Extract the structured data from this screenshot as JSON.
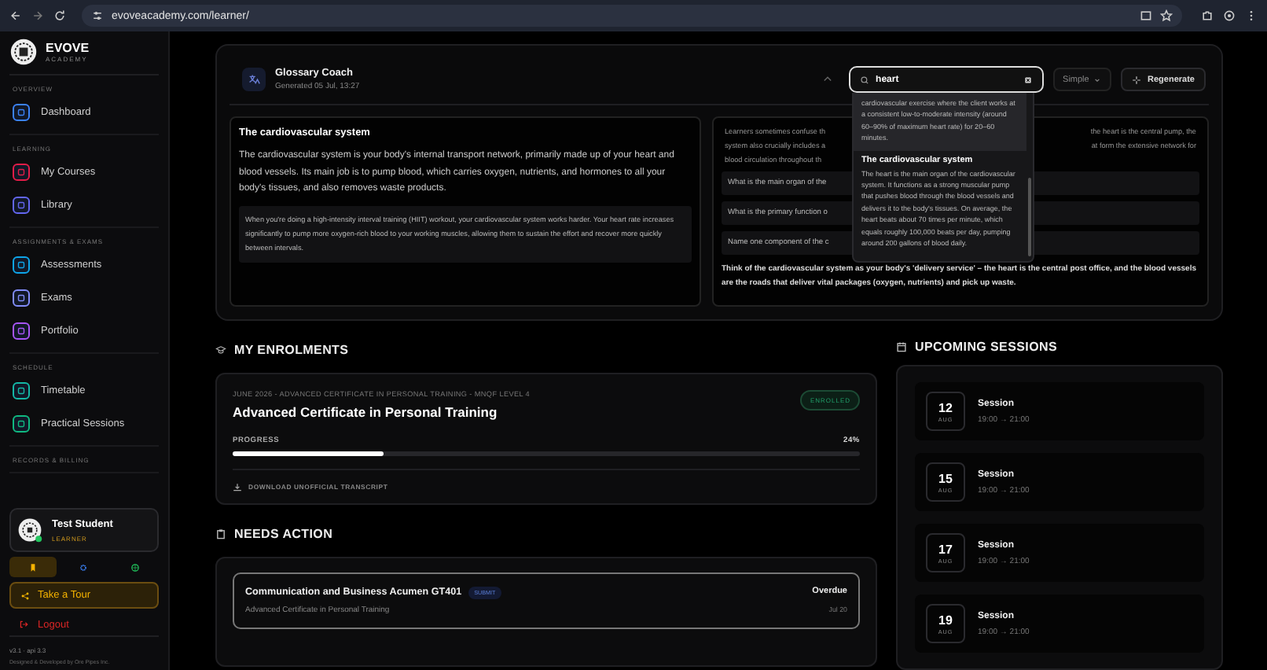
{
  "browser": {
    "url": "evoveacademy.com/learner/"
  },
  "sidebar": {
    "brand": {
      "name": "EVOVE",
      "tagline": "ACADEMY"
    },
    "sections": [
      {
        "heading": "OVERVIEW",
        "items": [
          {
            "label": "Dashboard",
            "color": "#3b82f6"
          }
        ]
      },
      {
        "heading": "LEARNING",
        "items": [
          {
            "label": "My Courses",
            "color": "#e11d48"
          },
          {
            "label": "Library",
            "color": "#6366f1"
          }
        ]
      },
      {
        "heading": "ASSIGNMENTS & EXAMS",
        "items": [
          {
            "label": "Assessments",
            "color": "#0ea5e9"
          },
          {
            "label": "Exams",
            "color": "#818cf8"
          },
          {
            "label": "Portfolio",
            "color": "#a855f7"
          }
        ]
      },
      {
        "heading": "SCHEDULE",
        "items": [
          {
            "label": "Timetable",
            "color": "#14b8a6"
          },
          {
            "label": "Practical Sessions",
            "color": "#10b981"
          }
        ]
      },
      {
        "heading": "RECORDS & BILLING"
      }
    ],
    "user": {
      "name": "Test Student",
      "role": "LEARNER"
    },
    "quick_tabs": [
      {
        "kind": "bookmark",
        "selected": true
      },
      {
        "kind": "gear",
        "selected": false
      },
      {
        "kind": "globe",
        "selected": false
      }
    ],
    "tour_button": "Take a Tour",
    "logout": "Logout",
    "version": "v3.1 · api 3.3",
    "credit": "Designed & Developed by Ore Pipes Inc."
  },
  "glossary": {
    "title": "Glossary Coach",
    "generated": "Generated 05 Jul, 13:27",
    "search": {
      "value": "heart"
    },
    "mode": "Simple",
    "regenerate": "Regenerate",
    "term": {
      "title": "The cardiovascular system",
      "definition": "The cardiovascular system is your body's internal transport network, primarily made up of your heart and blood vessels. Its main job is to pump blood, which carries oxygen, nutrients, and hormones to all your body's tissues, and also removes waste products.",
      "example": "When you're doing a high-intensity interval training (HIIT) workout, your cardiovascular system works harder. Your heart rate increases significantly to pump more oxygen-rich blood to your working muscles, allowing them to sustain the effort and recover more quickly between intervals."
    },
    "related": {
      "lines": [
        {
          "left": "Learners sometimes confuse th",
          "right": "the heart is the central pump, the"
        },
        {
          "left": "system also crucially includes a",
          "right": "at form the extensive network for"
        },
        {
          "left": "blood circulation throughout th"
        }
      ],
      "questions": [
        "What is the main organ of the",
        "What is the primary function o",
        "Name one component of the c"
      ],
      "analogy": "Think of the cardiovascular system as your body's 'delivery service' – the heart is the central post office, and the blood vessels are the roads that deliver vital packages (oxygen, nutrients) and pick up waste."
    },
    "results": [
      {
        "body": "cardiovascular exercise where the client works at a consistent low-to-moderate intensity (around 60–90% of maximum heart rate) for 20–60 minutes.",
        "selected": true
      },
      {
        "title": "The cardiovascular system",
        "body": "The heart is the main organ of the cardiovascular system. It functions as a strong muscular pump that pushes blood through the blood vessels and delivers it to the body's tissues. On average, the heart beats about 70 times per minute, which equals roughly 100,000 beats per day, pumping around 200 gallons of blood daily.",
        "selected": false
      }
    ]
  },
  "enrolments": {
    "heading": "MY ENROLMENTS",
    "items": [
      {
        "meta": "JUNE 2026 - ADVANCED CERTIFICATE IN PERSONAL TRAINING - MNQF LEVEL 4",
        "title": "Advanced Certificate in Personal Training",
        "status": "ENROLLED",
        "progress_label": "PROGRESS",
        "progress_text": "24%",
        "level": 0.24,
        "download": "DOWNLOAD UNOFFICIAL TRANSCRIPT"
      }
    ]
  },
  "needs_action": {
    "heading": "NEEDS ACTION",
    "items": [
      {
        "title": "Communication and Business Acumen GT401",
        "tag": "SUBMIT",
        "course": "Advanced Certificate in Personal Training",
        "status": "Overdue",
        "date": "Jul 20"
      }
    ]
  },
  "sessions": {
    "heading": "UPCOMING SESSIONS",
    "items": [
      {
        "day": "12",
        "month": "AUG",
        "title": "Session",
        "time": "19:00 → 21:00"
      },
      {
        "day": "15",
        "month": "AUG",
        "title": "Session",
        "time": "19:00 → 21:00"
      },
      {
        "day": "17",
        "month": "AUG",
        "title": "Session",
        "time": "19:00 → 21:00"
      },
      {
        "day": "19",
        "month": "AUG",
        "title": "Session",
        "time": "19:00 → 21:00"
      }
    ]
  }
}
